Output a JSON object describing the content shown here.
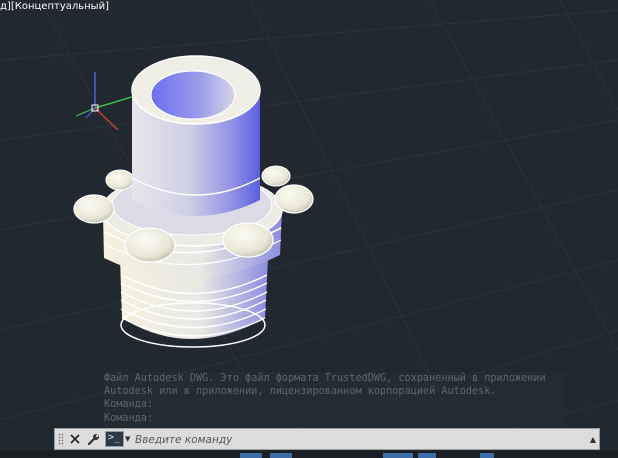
{
  "viewport": {
    "label_parts": [
      "д",
      "][",
      "Концептуальный",
      "]"
    ],
    "background_color": "#212830",
    "model": "threaded-pipe-fitting"
  },
  "ucs_icon": {
    "x_color": "#c43a3a",
    "y_color": "#3fbf4a",
    "z_color": "#4a5ed8"
  },
  "command_history": {
    "lines": [
      "Файл Autodesk DWG. Это файл формата TrustedDWG, сохраненный в приложении",
      "Autodesk или в приложении, лицензированном корпорацией Autodesk.",
      "Команда:",
      "Команда:"
    ]
  },
  "command_line": {
    "close_icon": "close-icon",
    "customize_icon": "wrench-icon",
    "prompt_icon": "command-prompt-icon",
    "placeholder": "Введите команду",
    "recent_icon": "chevron-up-icon"
  },
  "statusbar": {
    "accent_color": "#3b6ea8"
  }
}
